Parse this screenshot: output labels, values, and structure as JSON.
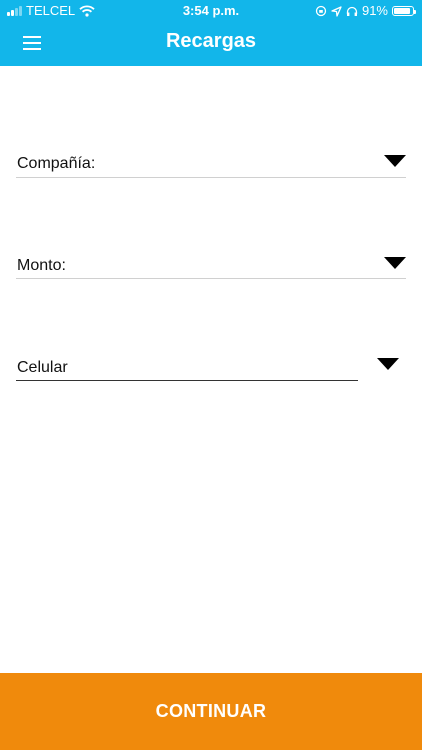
{
  "status_bar": {
    "carrier": "TELCEL",
    "time": "3:54 p.m.",
    "battery": "91%",
    "battery_level": 0.91,
    "icons": [
      "signal-bars-icon",
      "wifi-icon",
      "lock-rotation-icon",
      "location-arrow-icon",
      "headphones-icon",
      "battery-icon"
    ]
  },
  "header": {
    "title": "Recargas",
    "menu_icon": "hamburger-menu-icon",
    "background_color": "#12b6ea"
  },
  "form": {
    "company_label": "Compañía:",
    "amount_label": "Monto:",
    "phone_label": "Celular",
    "dropdown_icon": "triangle-down-icon"
  },
  "footer": {
    "continue_label": "CONTINUAR",
    "background_color": "#f08a0c"
  }
}
